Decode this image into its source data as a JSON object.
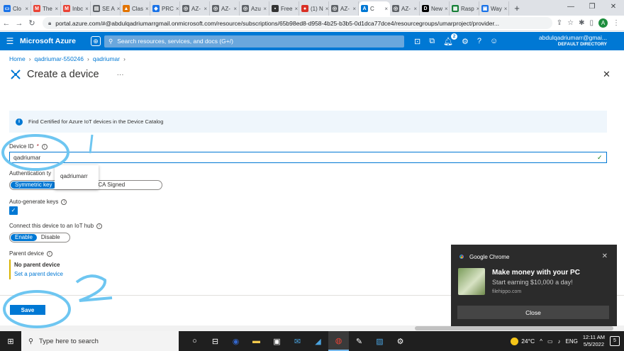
{
  "browser": {
    "tabs": [
      {
        "label": "Clo",
        "color": "#1a73e8",
        "glyph": "▭"
      },
      {
        "label": "The",
        "color": "#ea4335",
        "glyph": "M"
      },
      {
        "label": "Inbc",
        "color": "#ea4335",
        "glyph": "M"
      },
      {
        "label": "SE A",
        "color": "#5f6368",
        "glyph": "▤"
      },
      {
        "label": "Clas",
        "color": "#e37400",
        "glyph": "▲"
      },
      {
        "label": "PRC",
        "color": "#1a73e8",
        "glyph": "◆"
      },
      {
        "label": "AZ-",
        "color": "#5f6368",
        "glyph": "◎"
      },
      {
        "label": "AZ-",
        "color": "#5f6368",
        "glyph": "◎"
      },
      {
        "label": "Azu",
        "color": "#5f6368",
        "glyph": "◎"
      },
      {
        "label": "Free",
        "color": "#333333",
        "glyph": "▪"
      },
      {
        "label": "(1) N",
        "color": "#d93025",
        "glyph": "●"
      },
      {
        "label": "AZ-",
        "color": "#5f6368",
        "glyph": "◎"
      },
      {
        "label": "C",
        "color": "#0078d4",
        "glyph": "A"
      },
      {
        "label": "AZ-",
        "color": "#5f6368",
        "glyph": "◎"
      },
      {
        "label": "New",
        "color": "#000000",
        "glyph": "D"
      },
      {
        "label": "Rasp",
        "color": "#188038",
        "glyph": "▦"
      },
      {
        "label": "Way",
        "color": "#1a73e8",
        "glyph": "▣"
      }
    ],
    "active_tab_index": 12,
    "url": "portal.azure.com/#@abdulqadriumarrgmail.onmicrosoft.com/resource/subscriptions/65b98ed8-d958-4b25-b3b5-0d1dca77dce4/resourcegroups/umarproject/provider...",
    "profile_initial": "A"
  },
  "azure": {
    "brand": "Microsoft Azure",
    "search_placeholder": "Search resources, services, and docs (G+/)",
    "notification_count": "2",
    "account_email": "abdulqadriumarr@gmai...",
    "account_dir": "DEFAULT DIRECTORY"
  },
  "page": {
    "breadcrumb": [
      "Home",
      "qadriumar-550246",
      "qadriumar"
    ],
    "title": "Create a device",
    "info_text": "Find Certified for Azure IoT devices in the Device Catalog",
    "device_id_label": "Device ID",
    "device_id_value": "qadriumar",
    "autocomplete_suggestion": "qadriumarr",
    "auth_label": "Authentication ty",
    "auth_options": [
      "Symmetric key",
      "gned",
      "X.509 CA Signed"
    ],
    "auto_keys_label": "Auto-generate keys",
    "connect_label": "Connect this device to an IoT hub",
    "connect_options": [
      "Enable",
      "Disable"
    ],
    "parent_label": "Parent device",
    "no_parent": "No parent device",
    "set_parent": "Set a parent device",
    "save_label": "Save"
  },
  "annotations": {
    "mark1": "1",
    "mark2": "2"
  },
  "toast": {
    "app": "Google Chrome",
    "heading": "Make money with your PC",
    "subtext": "Start earning $10,000 a day!",
    "source": "filehippo.com",
    "close_label": "Close"
  },
  "taskbar": {
    "search_placeholder": "Type here to search",
    "temperature": "24°C",
    "language": "ENG",
    "time": "12:11 AM",
    "date": "5/5/2022",
    "notification_count": "5"
  },
  "colors": {
    "azure_blue": "#0078d4",
    "annotation": "#6ec6f1"
  }
}
